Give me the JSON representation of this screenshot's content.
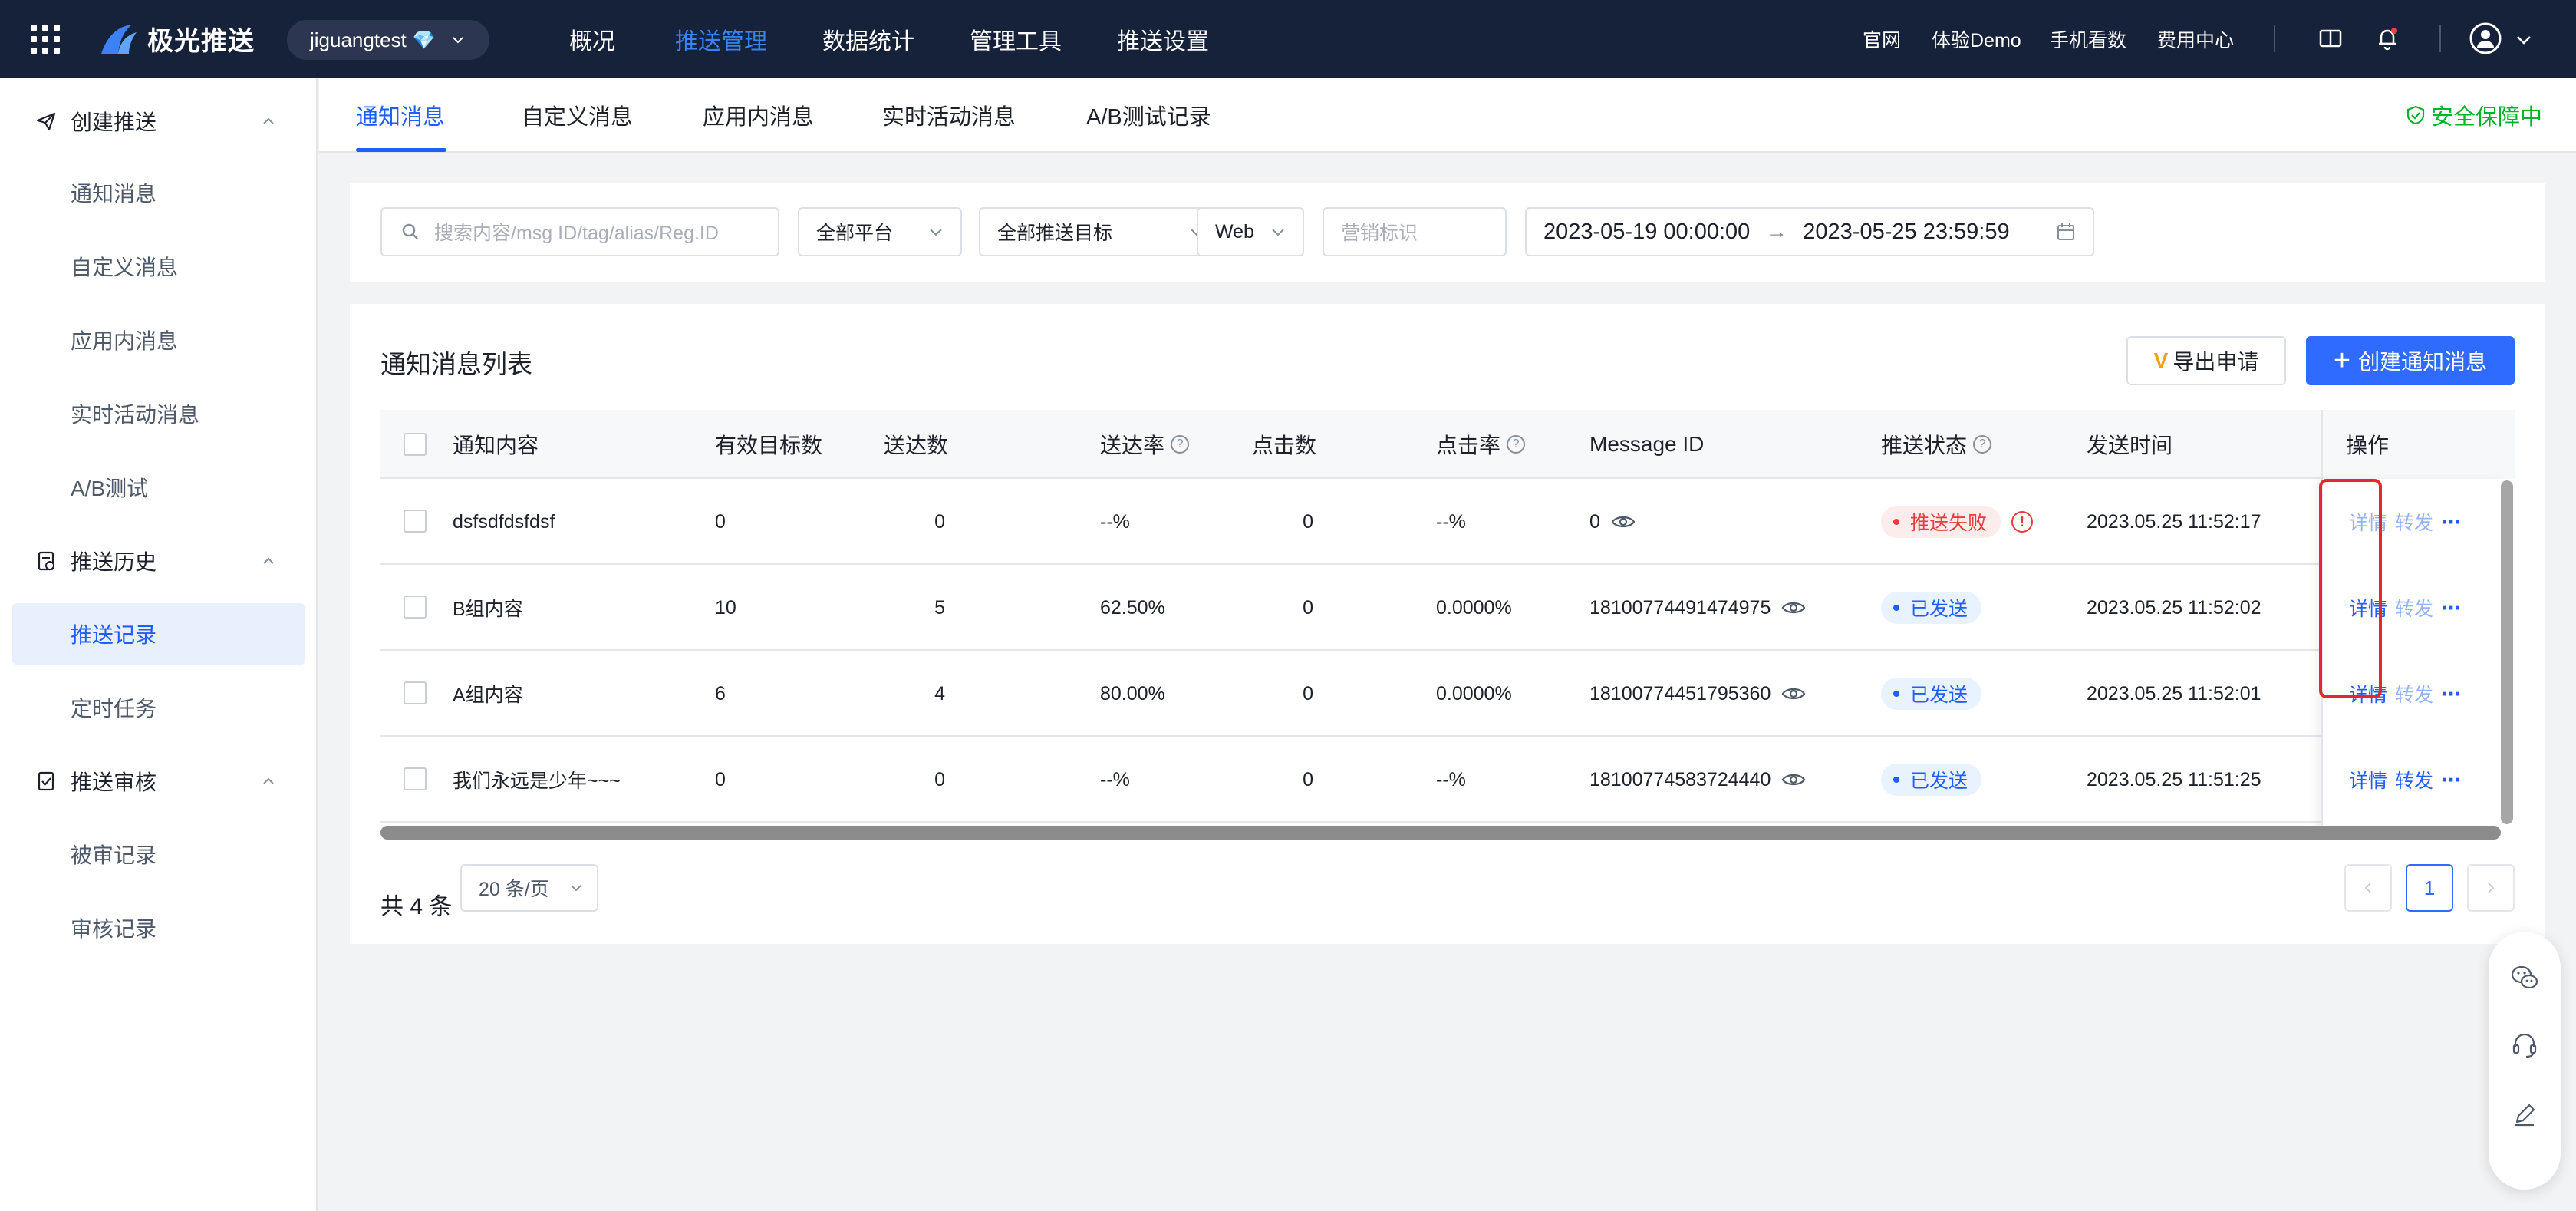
{
  "topbar": {
    "brand": "极光推送",
    "account": "jiguangtest",
    "nav": [
      "概况",
      "推送管理",
      "数据统计",
      "管理工具",
      "推送设置"
    ],
    "nav_active": "推送管理",
    "links": [
      "官网",
      "体验Demo",
      "手机看数",
      "费用中心"
    ]
  },
  "sidebar": {
    "groups": [
      {
        "label": "创建推送",
        "items": [
          "通知消息",
          "自定义消息",
          "应用内消息",
          "实时活动消息",
          "A/B测试"
        ]
      },
      {
        "label": "推送历史",
        "items": [
          "推送记录",
          "定时任务"
        ]
      },
      {
        "label": "推送审核",
        "items": [
          "被审记录",
          "审核记录"
        ]
      }
    ],
    "active_item": "推送记录"
  },
  "tabs": {
    "items": [
      "通知消息",
      "自定义消息",
      "应用内消息",
      "实时活动消息",
      "A/B测试记录"
    ],
    "active": "通知消息",
    "safe_label": "安全保障中"
  },
  "filters": {
    "search_placeholder": "搜索内容/msg ID/tag/alias/Reg.ID",
    "platform": "全部平台",
    "target": "全部推送目标",
    "channel": "Web",
    "marketing_placeholder": "营销标识",
    "date_start": "2023-05-19 00:00:00",
    "date_arrow": "→",
    "date_end": "2023-05-25 23:59:59"
  },
  "list": {
    "title": "通知消息列表",
    "export_label": "导出申请",
    "create_label": "创建通知消息",
    "columns": [
      "通知内容",
      "有效目标数",
      "送达数",
      "送达率",
      "点击数",
      "点击率",
      "Message ID",
      "推送状态",
      "发送时间",
      "操作"
    ],
    "rows": [
      {
        "content": "dsfsdfdsfdsf",
        "targets": "0",
        "delivered": "0",
        "rate": "--%",
        "clicks": "0",
        "click_rate": "--%",
        "msg_id": "0",
        "status": "推送失败",
        "status_type": "fail",
        "time": "2023.05.25 11:52:17",
        "detail": "详情",
        "forward": "转发",
        "detail_enabled": false,
        "forward_enabled": false
      },
      {
        "content": "B组内容",
        "targets": "10",
        "delivered": "5",
        "rate": "62.50%",
        "clicks": "0",
        "click_rate": "0.0000%",
        "msg_id": "18100774491474975",
        "status": "已发送",
        "status_type": "ok",
        "time": "2023.05.25 11:52:02",
        "detail": "详情",
        "forward": "转发",
        "detail_enabled": true,
        "forward_enabled": false
      },
      {
        "content": "A组内容",
        "targets": "6",
        "delivered": "4",
        "rate": "80.00%",
        "clicks": "0",
        "click_rate": "0.0000%",
        "msg_id": "18100774451795360",
        "status": "已发送",
        "status_type": "ok",
        "time": "2023.05.25 11:52:01",
        "detail": "详情",
        "forward": "转发",
        "detail_enabled": true,
        "forward_enabled": false
      },
      {
        "content": "我们永远是少年~~~",
        "targets": "0",
        "delivered": "0",
        "rate": "--%",
        "clicks": "0",
        "click_rate": "--%",
        "msg_id": "18100774583724440",
        "status": "已发送",
        "status_type": "ok",
        "time": "2023.05.25 11:51:25",
        "detail": "详情",
        "forward": "转发",
        "detail_enabled": true,
        "forward_enabled": true
      }
    ],
    "total": "共 4 条",
    "page_size": "20 条/页",
    "current_page": "1"
  },
  "colors": {
    "accent": "#2f6bff",
    "topbar": "#16213a",
    "fail": "#e83b3b",
    "safe": "#00b42a"
  }
}
